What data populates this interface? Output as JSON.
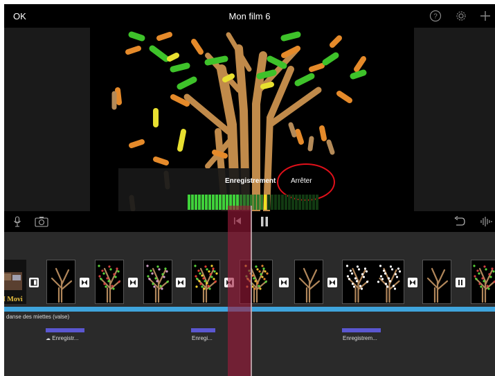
{
  "topbar": {
    "ok_label": "OK",
    "title": "Mon film 6",
    "icons": [
      "help-icon",
      "gear-icon",
      "plus-icon"
    ]
  },
  "recording": {
    "status_label": "Enregistrement",
    "stop_label": "Arrêter",
    "meter_level": 0.6,
    "highlight_color": "#e0101a"
  },
  "toolbar": {
    "icons": [
      "microphone-icon",
      "camera-icon",
      "skip-to-start-icon",
      "pause-icon",
      "undo-icon",
      "waveform-icon"
    ]
  },
  "timeline": {
    "first_clip_text": "I Movi",
    "audio_track_label": "danse des miettes (valse)",
    "voiceover_clips": [
      "Enregistr...",
      "Enregi...",
      "Enregistrem..."
    ],
    "audio_color": "#3fa4dc",
    "voiceover_color": "#5b57d1",
    "playhead_color": "#9c1a3a"
  }
}
